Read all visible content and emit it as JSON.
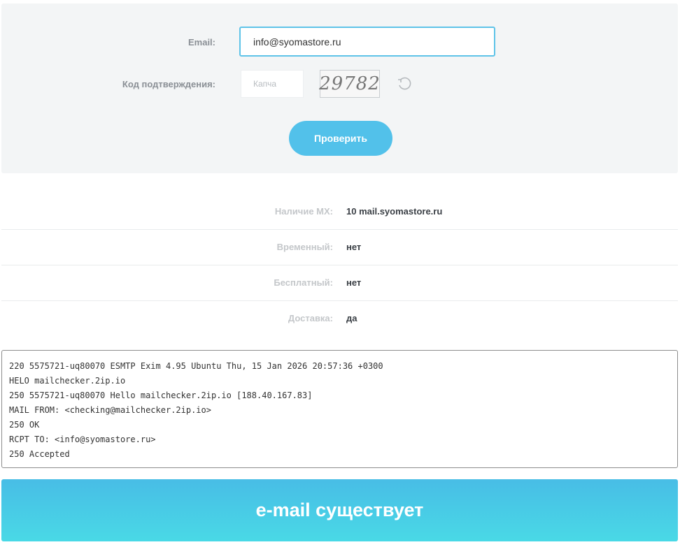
{
  "form": {
    "email_label": "Email:",
    "email_value": "info@syomastore.ru",
    "code_label": "Код подтверждения:",
    "captcha_placeholder": "Капча",
    "captcha_text": "29782",
    "check_label": "Проверить",
    "refresh_icon": "refresh-icon"
  },
  "results": [
    {
      "key": "Наличие MX:",
      "value": "10 mail.syomastore.ru"
    },
    {
      "key": "Временный:",
      "value": "нет"
    },
    {
      "key": "Бесплатный:",
      "value": "нет"
    },
    {
      "key": "Доставка:",
      "value": "да"
    }
  ],
  "log": [
    "220 5575721-uq80070 ESMTP Exim 4.95 Ubuntu Thu, 15 Jan 2026 20:57:36 +0300",
    "HELO mailchecker.2ip.io",
    "250 5575721-uq80070 Hello mailchecker.2ip.io [188.40.167.83]",
    "MAIL FROM: <checking@mailchecker.2ip.io>",
    "250 OK",
    "RCPT TO: <info@syomastore.ru>",
    "250 Accepted"
  ],
  "banner": {
    "text": "e-mail существует"
  },
  "colors": {
    "accent": "#52c1ea",
    "panel": "#f3f5f6"
  }
}
